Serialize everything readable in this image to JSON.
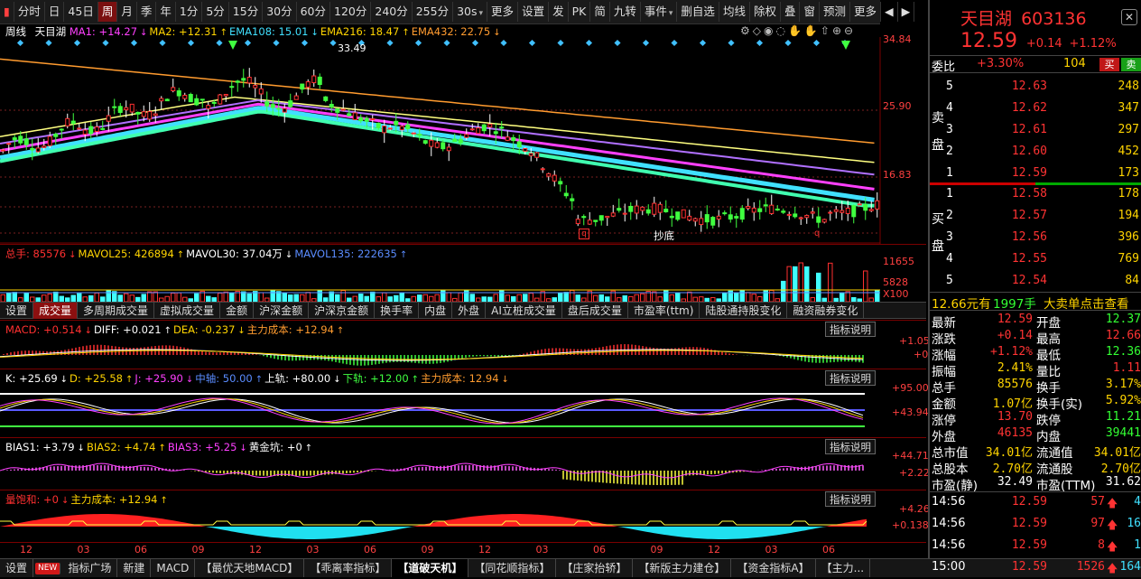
{
  "toolbar": {
    "periods": [
      "分时",
      "日",
      "45日",
      "周",
      "月",
      "季",
      "年",
      "1分",
      "5分",
      "15分",
      "30分",
      "60分",
      "120分",
      "240分",
      "255分",
      "30s",
      "更多",
      "设置"
    ],
    "active_period": "周",
    "right_buttons": [
      "发",
      "PK",
      "简",
      "九转",
      "事件",
      "删自选",
      "均线",
      "除权",
      "叠",
      "窗",
      "预测",
      "更多"
    ]
  },
  "main_chart": {
    "period_label": "周线",
    "stock_name": "天目湖",
    "ma": [
      {
        "text": "MA1: +14.27",
        "color": "#ff40ff"
      },
      {
        "text": "MA2: +12.31",
        "color": "#ffd400"
      },
      {
        "text": "EMA108: 15.01",
        "color": "#40e0ff"
      },
      {
        "text": "EMA216: 18.47",
        "color": "#ffd400"
      },
      {
        "text": "EMA432: 22.75",
        "color": "#ff9b2f"
      }
    ],
    "axis_labels": [
      "34.84",
      "25.90",
      "16.83"
    ],
    "high_label": "33.49",
    "bottom_label": "抄底",
    "signal_q": "q"
  },
  "volume": {
    "labels": [
      {
        "text": "总手: 85576",
        "color": "#ff3030"
      },
      {
        "text": "MAVOL25: 426894",
        "color": "#ffd400"
      },
      {
        "text": "MAVOL30: 37.04万",
        "color": "#ffffff"
      },
      {
        "text": "MAVOL135: 222635",
        "color": "#5a8cff"
      }
    ],
    "axis_labels": [
      "11655",
      "5828",
      "X100"
    ]
  },
  "tabs": [
    "设置",
    "成交量",
    "多周期成交量",
    "虚拟成交量",
    "金额",
    "沪深金额",
    "沪深京金额",
    "换手率",
    "内盘",
    "外盘",
    "AI立桩成交量",
    "盘后成交量",
    "市盈率(ttm)",
    "陆股通持股变化",
    "融资融券变化"
  ],
  "active_tab": "成交量",
  "macd": {
    "labels": [
      {
        "text": "MACD: +0.514",
        "color": "#ff3030"
      },
      {
        "text": "DIFF: +0.021",
        "color": "#ffffff"
      },
      {
        "text": "DEA: -0.237",
        "color": "#ffd400"
      },
      {
        "text": "主力成本: +12.94",
        "color": "#ff9b2f"
      }
    ],
    "axis_labels": [
      "+1.05",
      "+0"
    ],
    "explain": "指标说明"
  },
  "kdj": {
    "labels": [
      {
        "text": "K: +25.69",
        "color": "#ffffff"
      },
      {
        "text": "D: +25.58",
        "color": "#ffd400"
      },
      {
        "text": "J: +25.90",
        "color": "#ff40ff"
      },
      {
        "text": "中轴: 50.00",
        "color": "#5a8cff"
      },
      {
        "text": "上轨: +80.00",
        "color": "#ffffff"
      },
      {
        "text": "下轨: +12.00",
        "color": "#40ff40"
      },
      {
        "text": "主力成本: 12.94",
        "color": "#ff9b2f"
      }
    ],
    "axis_labels": [
      "+95.00",
      "+43.94"
    ],
    "explain": "指标说明"
  },
  "bias": {
    "labels": [
      {
        "text": "BIAS1: +3.79",
        "color": "#ffffff"
      },
      {
        "text": "BIAS2: +4.74",
        "color": "#ffd400"
      },
      {
        "text": "BIAS3: +5.25",
        "color": "#ff40ff"
      },
      {
        "text": "黄金坑: +0",
        "color": "#ffffff"
      }
    ],
    "axis_labels": [
      "+44.71",
      "+2.22"
    ],
    "explain": "指标说明"
  },
  "sat": {
    "labels": [
      {
        "text": "量饱和: +0",
        "color": "#ff3030"
      },
      {
        "text": "主力成本: +12.94",
        "color": "#ffd400"
      }
    ],
    "axis_labels": [
      "+4.26",
      "+0.138"
    ],
    "explain": "指标说明"
  },
  "x_axis": [
    "12",
    "03",
    "06",
    "09",
    "12",
    "03",
    "06",
    "09",
    "12",
    "03",
    "06",
    "09",
    "12",
    "03",
    "06"
  ],
  "bottom_tabs": [
    "设置",
    "NEW",
    "指标广场",
    "新建",
    "MACD",
    "【最优天地MACD】",
    "【乖离率指标】",
    "【道破天机】",
    "【同花顺指标】",
    "【庄家抬轿】",
    "【新版主力建仓】",
    "【资金指标A】",
    "【主力..."
  ],
  "bottom_active": "【道破天机】",
  "quote": {
    "name": "天目湖",
    "code": "603136",
    "price": "12.59",
    "change": "+0.14",
    "pct": "+1.12%",
    "weibi_label": "委比",
    "weibi": "+3.30%",
    "weicha": "104",
    "buy_btn": "买",
    "sell_btn": "卖",
    "sell_side_label": [
      "卖",
      "盘"
    ],
    "buy_side_label": [
      "买",
      "盘"
    ],
    "asks": [
      {
        "lvl": "5",
        "price": "12.63",
        "vol": "248"
      },
      {
        "lvl": "4",
        "price": "12.62",
        "vol": "347"
      },
      {
        "lvl": "3",
        "price": "12.61",
        "vol": "297"
      },
      {
        "lvl": "2",
        "price": "12.60",
        "vol": "452"
      },
      {
        "lvl": "1",
        "price": "12.59",
        "vol": "173"
      }
    ],
    "bids": [
      {
        "lvl": "1",
        "price": "12.58",
        "vol": "178"
      },
      {
        "lvl": "2",
        "price": "12.57",
        "vol": "194"
      },
      {
        "lvl": "3",
        "price": "12.56",
        "vol": "396"
      },
      {
        "lvl": "4",
        "price": "12.55",
        "vol": "769"
      },
      {
        "lvl": "5",
        "price": "12.54",
        "vol": "84"
      }
    ],
    "big_order_price": "12.66元有",
    "big_order_vol": "1997手",
    "big_order_link": "大卖单点击查看",
    "stats": [
      {
        "l1": "最新",
        "v1": "12.59",
        "c1": "up",
        "l2": "开盘",
        "v2": "12.37",
        "c2": "dn"
      },
      {
        "l1": "涨跌",
        "v1": "+0.14",
        "c1": "up",
        "l2": "最高",
        "v2": "12.66",
        "c2": "up"
      },
      {
        "l1": "涨幅",
        "v1": "+1.12%",
        "c1": "up",
        "l2": "最低",
        "v2": "12.36",
        "c2": "dn"
      },
      {
        "l1": "振幅",
        "v1": "2.41%",
        "c1": "yel",
        "l2": "量比",
        "v2": "1.11",
        "c2": "up"
      },
      {
        "l1": "总手",
        "v1": "85576",
        "c1": "yel",
        "l2": "换手",
        "v2": "3.17%",
        "c2": "yel"
      },
      {
        "l1": "金额",
        "v1": "1.07亿",
        "c1": "yel",
        "l2": "换手(实)",
        "v2": "5.92%",
        "c2": "yel"
      },
      {
        "l1": "涨停",
        "v1": "13.70",
        "c1": "up",
        "l2": "跌停",
        "v2": "11.21",
        "c2": "dn"
      },
      {
        "l1": "外盘",
        "v1": "46135",
        "c1": "up",
        "l2": "内盘",
        "v2": "39441",
        "c2": "dn"
      },
      {
        "l1": "总市值",
        "v1": "34.01亿",
        "c1": "yel",
        "l2": "流通值",
        "v2": "34.01亿",
        "c2": "yel"
      },
      {
        "l1": "总股本",
        "v1": "2.70亿",
        "c1": "yel",
        "l2": "流通股",
        "v2": "2.70亿",
        "c2": "yel"
      },
      {
        "l1": "市盈(静)",
        "v1": "32.49",
        "c1": "wht",
        "l2": "市盈(TTM)",
        "v2": "31.62",
        "c2": "wht"
      }
    ],
    "ticks": [
      {
        "time": "14:56",
        "price": "12.59",
        "vol": "57",
        "n": "4"
      },
      {
        "time": "14:56",
        "price": "12.59",
        "vol": "97",
        "n": "16"
      },
      {
        "time": "14:56",
        "price": "12.59",
        "vol": "8",
        "n": "1"
      },
      {
        "time": "15:00",
        "price": "12.59",
        "vol": "1526",
        "n": "164"
      }
    ]
  }
}
